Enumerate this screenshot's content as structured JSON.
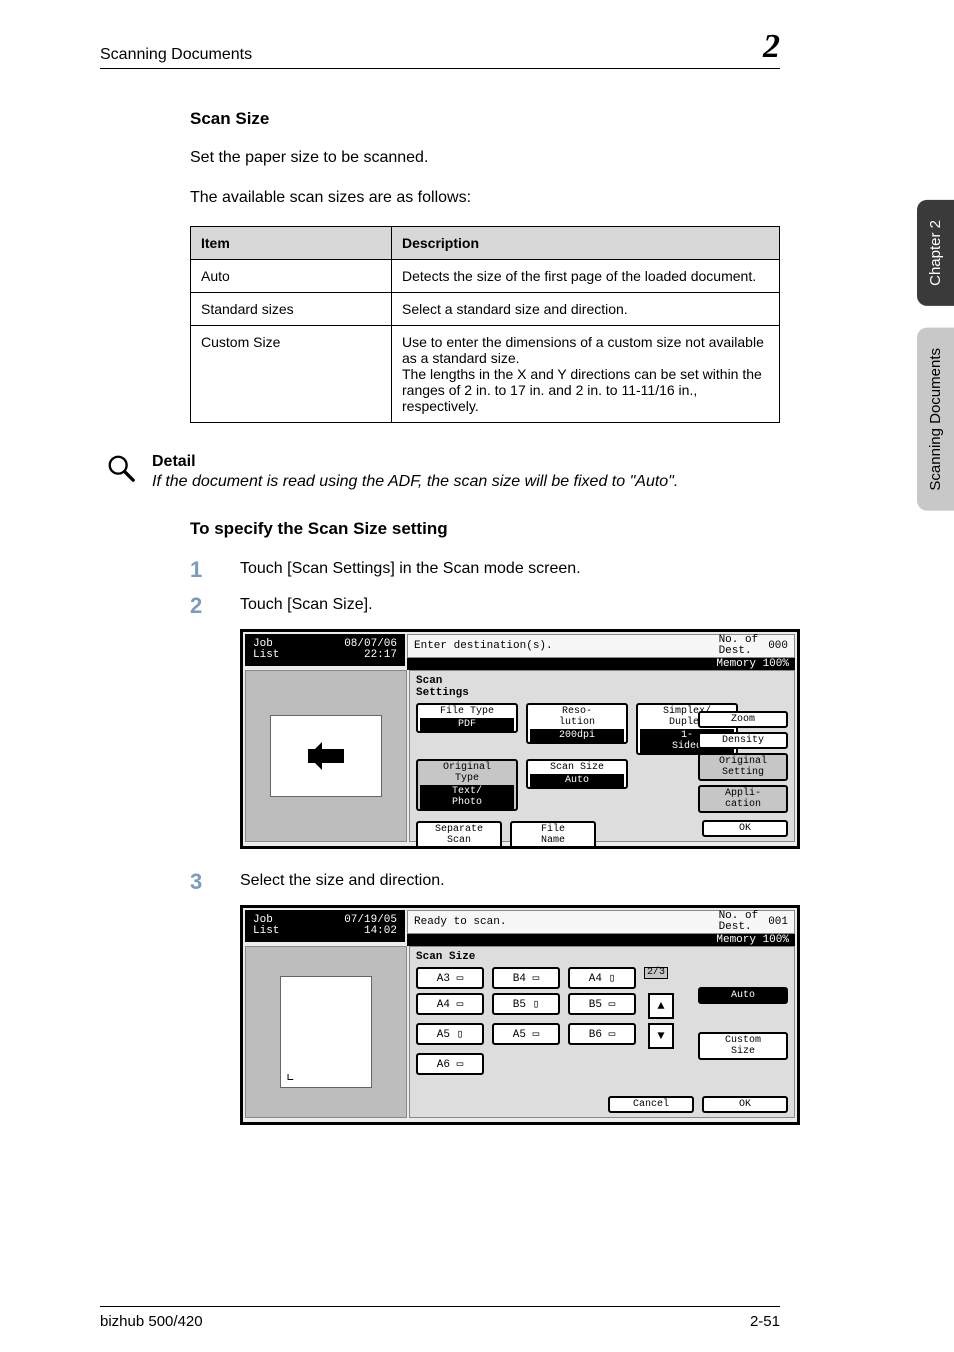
{
  "runhead": {
    "title": "Scanning Documents",
    "chapnum": "2"
  },
  "section": {
    "heading": "Scan Size",
    "p1": "Set the paper size to be scanned.",
    "p2": "The available scan sizes are as follows:"
  },
  "table": {
    "h1": "Item",
    "h2": "Description",
    "rows": [
      {
        "item": "Auto",
        "desc": "Detects the size of the first page of the loaded document."
      },
      {
        "item": "Standard sizes",
        "desc": "Select a standard size and direction."
      },
      {
        "item": "Custom Size",
        "desc": "Use to enter the dimensions of a custom size not available as a standard size.\nThe lengths in the X and Y directions can be set within the ranges of 2 in. to 17 in. and 2 in. to 11-11/16 in., respectively."
      }
    ]
  },
  "detail": {
    "heading": "Detail",
    "text": "If the document is read using the ADF, the scan size will be fixed to \"Auto\"."
  },
  "proc": {
    "heading": "To specify the Scan Size setting",
    "steps": [
      {
        "n": "1",
        "text": "Touch [Scan Settings] in the Scan mode screen."
      },
      {
        "n": "2",
        "text": "Touch [Scan Size]."
      },
      {
        "n": "3",
        "text": "Select the size and direction."
      }
    ]
  },
  "shot1": {
    "job": "Job\nList",
    "date": "08/07/06\n22:17",
    "status": "Enter destination(s).",
    "dest_label": "No. of\nDest.",
    "dest_val": "000",
    "memory": "Memory 100%",
    "panel_title": "Scan\nSettings",
    "cols": [
      {
        "label": "File Type",
        "value": "PDF"
      },
      {
        "label": "Reso-\nlution",
        "value": "200dpi"
      },
      {
        "label": "Simplex/\nDuplex",
        "value": "1-\nSided"
      }
    ],
    "row2": [
      {
        "label": "Original\nType",
        "value": "Text/\nPhoto"
      },
      {
        "label": "Scan Size",
        "value": "Auto"
      }
    ],
    "bottom": [
      "Separate\nScan",
      "File\nName"
    ],
    "right": [
      "Zoom",
      "Density",
      "Original\nSetting",
      "Appli-\ncation"
    ],
    "ok": "OK"
  },
  "shot2": {
    "job": "Job\nList",
    "date": "07/19/05\n14:02",
    "status": "Ready to scan.",
    "dest_label": "No. of\nDest.",
    "dest_val": "001",
    "memory": "Memory 100%",
    "panel_title": "Scan Size",
    "grid": [
      [
        "A3 ▭",
        "B4 ▭",
        "A4 ▯"
      ],
      [
        "A4 ▭",
        "B5 ▯",
        "B5 ▭"
      ],
      [
        "A5 ▯",
        "A5 ▭",
        "B6 ▭"
      ],
      [
        "A6 ▭",
        "",
        ""
      ]
    ],
    "fraction": "2/3",
    "auto": "Auto",
    "custom": "Custom\nSize",
    "cancel": "Cancel",
    "ok": "OK"
  },
  "side": {
    "tab1": "Chapter 2",
    "tab2": "Scanning Documents"
  },
  "footer": {
    "left": "bizhub 500/420",
    "right": "2-51"
  }
}
